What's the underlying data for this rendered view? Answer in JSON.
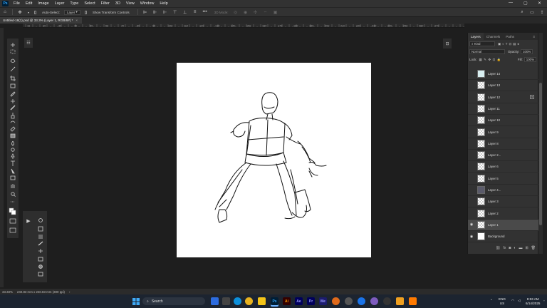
{
  "menubar": {
    "logo": "Ps",
    "items": [
      "File",
      "Edit",
      "Image",
      "Layer",
      "Type",
      "Select",
      "Filter",
      "3D",
      "View",
      "Window",
      "Help"
    ],
    "minimize": "—",
    "maximize": "▢",
    "close": "✕"
  },
  "options": {
    "auto_select_label": "Auto-Select:",
    "auto_select_value": "Layer",
    "show_transform": "Show Transform Controls",
    "mode_3d": "3D Mode:"
  },
  "document": {
    "tab_title": "Untitled-18(1).psd @ 33.3% (Layer 1, RGB/8#) *",
    "close": "×"
  },
  "ruler": {
    "ticks": [
      "10",
      "20",
      "30",
      "40",
      "50",
      "60",
      "70",
      "80",
      "90",
      "100",
      "110",
      "120",
      "130",
      "140",
      "150",
      "160",
      "170",
      "180",
      "190",
      "200",
      "210",
      "220",
      "230",
      "240",
      "250",
      "260",
      "270"
    ]
  },
  "layers_panel": {
    "tabs": [
      "Layers",
      "Channels",
      "Paths"
    ],
    "kind_label": "Kind",
    "blend_mode": "Normal",
    "opacity_label": "Opacity:",
    "opacity_value": "100%",
    "lock_label": "Lock:",
    "fill_label": "Fill:",
    "fill_value": "100%",
    "layers": [
      {
        "name": "Layer 14",
        "thumb": "teal",
        "visible": false,
        "fx": false
      },
      {
        "name": "Layer 13",
        "thumb": "checker",
        "visible": false,
        "fx": false
      },
      {
        "name": "Layer 12",
        "thumb": "checker",
        "visible": false,
        "fx": true
      },
      {
        "name": "Layer 11",
        "thumb": "checker",
        "visible": false,
        "fx": false
      },
      {
        "name": "Layer 10",
        "thumb": "checker",
        "visible": false,
        "fx": false
      },
      {
        "name": "Layer 9",
        "thumb": "checker",
        "visible": false,
        "fx": false
      },
      {
        "name": "Layer 8",
        "thumb": "checker",
        "visible": false,
        "fx": false
      },
      {
        "name": "Layer 2...",
        "thumb": "checker",
        "visible": false,
        "fx": false
      },
      {
        "name": "Layer 6",
        "thumb": "checker",
        "visible": false,
        "fx": false
      },
      {
        "name": "Layer 5",
        "thumb": "checker",
        "visible": false,
        "fx": false
      },
      {
        "name": "Layer 4...",
        "thumb": "grey",
        "visible": false,
        "fx": false
      },
      {
        "name": "Layer 3",
        "thumb": "checker",
        "visible": false,
        "fx": false
      },
      {
        "name": "Layer 2",
        "thumb": "checker",
        "visible": false,
        "fx": false
      },
      {
        "name": "Layer 1",
        "thumb": "checker",
        "visible": true,
        "fx": false,
        "selected": true
      },
      {
        "name": "Background",
        "thumb": "white",
        "visible": true,
        "fx": false
      }
    ]
  },
  "status": {
    "zoom": "33.33%",
    "doc_size": "240.83 mm x 240.83 mm (300 ppi)"
  },
  "taskbar": {
    "search_placeholder": "Search",
    "lang_top": "ENG",
    "lang_bottom": "US",
    "time": "8:53 AM",
    "date": "6/14/2025"
  }
}
